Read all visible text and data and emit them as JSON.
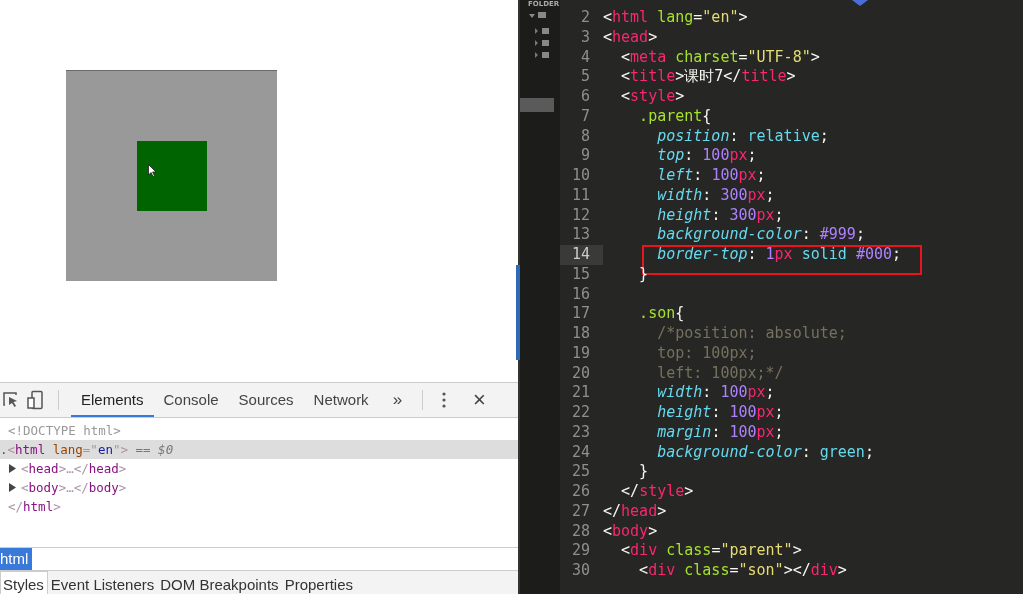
{
  "devtools": {
    "tabs": [
      {
        "label": "Elements",
        "selected": true
      },
      {
        "label": "Console",
        "selected": false
      },
      {
        "label": "Sources",
        "selected": false
      },
      {
        "label": "Network",
        "selected": false
      }
    ],
    "more": "»",
    "close": "×",
    "dom": [
      {
        "tokens": [
          {
            "kind": "doctype",
            "t": "<!DOCTYPE html>"
          }
        ],
        "selected": false
      },
      {
        "tokens": [
          {
            "kind": "dim",
            "t": "."
          },
          {
            "kind": "p",
            "t": "<"
          },
          {
            "kind": "tag",
            "t": "html"
          },
          {
            "kind": "attr",
            "t": " lang"
          },
          {
            "kind": "p",
            "t": "=\""
          },
          {
            "kind": "str",
            "t": "en"
          },
          {
            "kind": "p",
            "t": "\">"
          },
          {
            "kind": "eq",
            "t": " == $0"
          }
        ],
        "selected": true
      },
      {
        "expanded": false,
        "tokens": [
          {
            "kind": "p",
            "t": "<"
          },
          {
            "kind": "tag",
            "t": "head"
          },
          {
            "kind": "p",
            "t": ">…</"
          },
          {
            "kind": "tag",
            "t": "head"
          },
          {
            "kind": "p",
            "t": ">"
          }
        ],
        "selected": false
      },
      {
        "expanded": false,
        "tokens": [
          {
            "kind": "p",
            "t": "<"
          },
          {
            "kind": "tag",
            "t": "body"
          },
          {
            "kind": "p",
            "t": ">…</"
          },
          {
            "kind": "tag",
            "t": "body"
          },
          {
            "kind": "p",
            "t": ">"
          }
        ],
        "selected": false
      },
      {
        "tokens": [
          {
            "kind": "p",
            "t": "</"
          },
          {
            "kind": "tag",
            "t": "html"
          },
          {
            "kind": "p",
            "t": ">"
          }
        ],
        "selected": false
      }
    ],
    "breadcrumb": [
      {
        "label": "html",
        "selected": true
      }
    ],
    "subtabs": [
      {
        "label": "Styles",
        "selected": true
      },
      {
        "label": "Event Listeners",
        "selected": false
      },
      {
        "label": "DOM Breakpoints",
        "selected": false
      },
      {
        "label": "Properties",
        "selected": false
      }
    ]
  },
  "editor": {
    "sidebar": {
      "title": "FOLDER"
    },
    "lines": [
      {
        "number": "2",
        "tokens": [
          {
            "kind": "p",
            "t": "<"
          },
          {
            "kind": "tag",
            "t": "html"
          },
          {
            "kind": "attr",
            "t": " lang"
          },
          {
            "kind": "p",
            "t": "="
          },
          {
            "kind": "str",
            "t": "\"en\""
          },
          {
            "kind": "p",
            "t": ">"
          }
        ]
      },
      {
        "number": "3",
        "tokens": [
          {
            "kind": "p",
            "t": "<"
          },
          {
            "kind": "tag",
            "t": "head"
          },
          {
            "kind": "p",
            "t": ">"
          }
        ]
      },
      {
        "number": "4",
        "tokens": [
          {
            "kind": "p",
            "t": "  <"
          },
          {
            "kind": "tag",
            "t": "meta"
          },
          {
            "kind": "attr",
            "t": " charset"
          },
          {
            "kind": "p",
            "t": "="
          },
          {
            "kind": "str",
            "t": "\"UTF-8\""
          },
          {
            "kind": "p",
            "t": ">"
          }
        ]
      },
      {
        "number": "5",
        "tokens": [
          {
            "kind": "p",
            "t": "  <"
          },
          {
            "kind": "tag",
            "t": "title"
          },
          {
            "kind": "p",
            "t": ">课时7</"
          },
          {
            "kind": "tag",
            "t": "title"
          },
          {
            "kind": "p",
            "t": ">"
          }
        ]
      },
      {
        "number": "6",
        "tokens": [
          {
            "kind": "p",
            "t": "  <"
          },
          {
            "kind": "tag",
            "t": "style"
          },
          {
            "kind": "p",
            "t": ">"
          }
        ]
      },
      {
        "number": "7",
        "tokens": [
          {
            "kind": "sel",
            "t": "    .parent"
          },
          {
            "kind": "p",
            "t": "{"
          }
        ]
      },
      {
        "number": "8",
        "tokens": [
          {
            "kind": "prop",
            "t": "      position"
          },
          {
            "kind": "p",
            "t": ": "
          },
          {
            "kind": "val",
            "t": "relative"
          },
          {
            "kind": "p",
            "t": ";"
          }
        ]
      },
      {
        "number": "9",
        "tokens": [
          {
            "kind": "prop",
            "t": "      top"
          },
          {
            "kind": "p",
            "t": ": "
          },
          {
            "kind": "num",
            "t": "100"
          },
          {
            "kind": "unit",
            "t": "px"
          },
          {
            "kind": "p",
            "t": ";"
          }
        ]
      },
      {
        "number": "10",
        "tokens": [
          {
            "kind": "prop",
            "t": "      left"
          },
          {
            "kind": "p",
            "t": ": "
          },
          {
            "kind": "num",
            "t": "100"
          },
          {
            "kind": "unit",
            "t": "px"
          },
          {
            "kind": "p",
            "t": ";"
          }
        ]
      },
      {
        "number": "11",
        "tokens": [
          {
            "kind": "prop",
            "t": "      width"
          },
          {
            "kind": "p",
            "t": ": "
          },
          {
            "kind": "num",
            "t": "300"
          },
          {
            "kind": "unit",
            "t": "px"
          },
          {
            "kind": "p",
            "t": ";"
          }
        ]
      },
      {
        "number": "12",
        "tokens": [
          {
            "kind": "prop",
            "t": "      height"
          },
          {
            "kind": "p",
            "t": ": "
          },
          {
            "kind": "num",
            "t": "300"
          },
          {
            "kind": "unit",
            "t": "px"
          },
          {
            "kind": "p",
            "t": ";"
          }
        ]
      },
      {
        "number": "13",
        "tokens": [
          {
            "kind": "prop",
            "t": "      background-color"
          },
          {
            "kind": "p",
            "t": ": "
          },
          {
            "kind": "num",
            "t": "#999"
          },
          {
            "kind": "p",
            "t": ";"
          }
        ]
      },
      {
        "number": "14",
        "current": true,
        "marked": true,
        "tokens": [
          {
            "kind": "prop",
            "t": "      border-top"
          },
          {
            "kind": "p",
            "t": ": "
          },
          {
            "kind": "num",
            "t": "1"
          },
          {
            "kind": "unit",
            "t": "px"
          },
          {
            "kind": "val",
            "t": " solid "
          },
          {
            "kind": "num",
            "t": "#000"
          },
          {
            "kind": "p",
            "t": ";"
          }
        ]
      },
      {
        "number": "15",
        "tokens": [
          {
            "kind": "p",
            "t": "    }"
          }
        ]
      },
      {
        "number": "16"
      },
      {
        "number": "17",
        "tokens": [
          {
            "kind": "sel",
            "t": "    .son"
          },
          {
            "kind": "p",
            "t": "{"
          }
        ]
      },
      {
        "number": "18",
        "tokens": [
          {
            "kind": "comment",
            "t": "      /*position: absolute;"
          }
        ]
      },
      {
        "number": "19",
        "tokens": [
          {
            "kind": "comment",
            "t": "      top: 100px;"
          }
        ]
      },
      {
        "number": "20",
        "tokens": [
          {
            "kind": "comment",
            "t": "      left: 100px;*/"
          }
        ]
      },
      {
        "number": "21",
        "tokens": [
          {
            "kind": "prop",
            "t": "      width"
          },
          {
            "kind": "p",
            "t": ": "
          },
          {
            "kind": "num",
            "t": "100"
          },
          {
            "kind": "unit",
            "t": "px"
          },
          {
            "kind": "p",
            "t": ";"
          }
        ]
      },
      {
        "number": "22",
        "tokens": [
          {
            "kind": "prop",
            "t": "      height"
          },
          {
            "kind": "p",
            "t": ": "
          },
          {
            "kind": "num",
            "t": "100"
          },
          {
            "kind": "unit",
            "t": "px"
          },
          {
            "kind": "p",
            "t": ";"
          }
        ]
      },
      {
        "number": "23",
        "tokens": [
          {
            "kind": "prop",
            "t": "      margin"
          },
          {
            "kind": "p",
            "t": ": "
          },
          {
            "kind": "num",
            "t": "100"
          },
          {
            "kind": "unit",
            "t": "px"
          },
          {
            "kind": "p",
            "t": ";"
          }
        ]
      },
      {
        "number": "24",
        "tokens": [
          {
            "kind": "prop",
            "t": "      background-color"
          },
          {
            "kind": "p",
            "t": ": "
          },
          {
            "kind": "val",
            "t": "green"
          },
          {
            "kind": "p",
            "t": ";"
          }
        ]
      },
      {
        "number": "25",
        "tokens": [
          {
            "kind": "p",
            "t": "    }"
          }
        ]
      },
      {
        "number": "26",
        "tokens": [
          {
            "kind": "p",
            "t": "  </"
          },
          {
            "kind": "tag",
            "t": "style"
          },
          {
            "kind": "p",
            "t": ">"
          }
        ]
      },
      {
        "number": "27",
        "tokens": [
          {
            "kind": "p",
            "t": "</"
          },
          {
            "kind": "tag",
            "t": "head"
          },
          {
            "kind": "p",
            "t": ">"
          }
        ]
      },
      {
        "number": "28",
        "tokens": [
          {
            "kind": "p",
            "t": "<"
          },
          {
            "kind": "tag",
            "t": "body"
          },
          {
            "kind": "p",
            "t": ">"
          }
        ]
      },
      {
        "number": "29",
        "tokens": [
          {
            "kind": "p",
            "t": "  <"
          },
          {
            "kind": "tag",
            "t": "div"
          },
          {
            "kind": "attr",
            "t": " class"
          },
          {
            "kind": "p",
            "t": "="
          },
          {
            "kind": "str",
            "t": "\"parent\""
          },
          {
            "kind": "p",
            "t": ">"
          }
        ]
      },
      {
        "number": "30",
        "tokens": [
          {
            "kind": "p",
            "t": "    <"
          },
          {
            "kind": "tag",
            "t": "div"
          },
          {
            "kind": "attr",
            "t": " class"
          },
          {
            "kind": "p",
            "t": "="
          },
          {
            "kind": "str",
            "t": "\"son\""
          },
          {
            "kind": "p",
            "t": "></"
          },
          {
            "kind": "tag",
            "t": "div"
          },
          {
            "kind": "p",
            "t": ">"
          }
        ]
      }
    ]
  }
}
